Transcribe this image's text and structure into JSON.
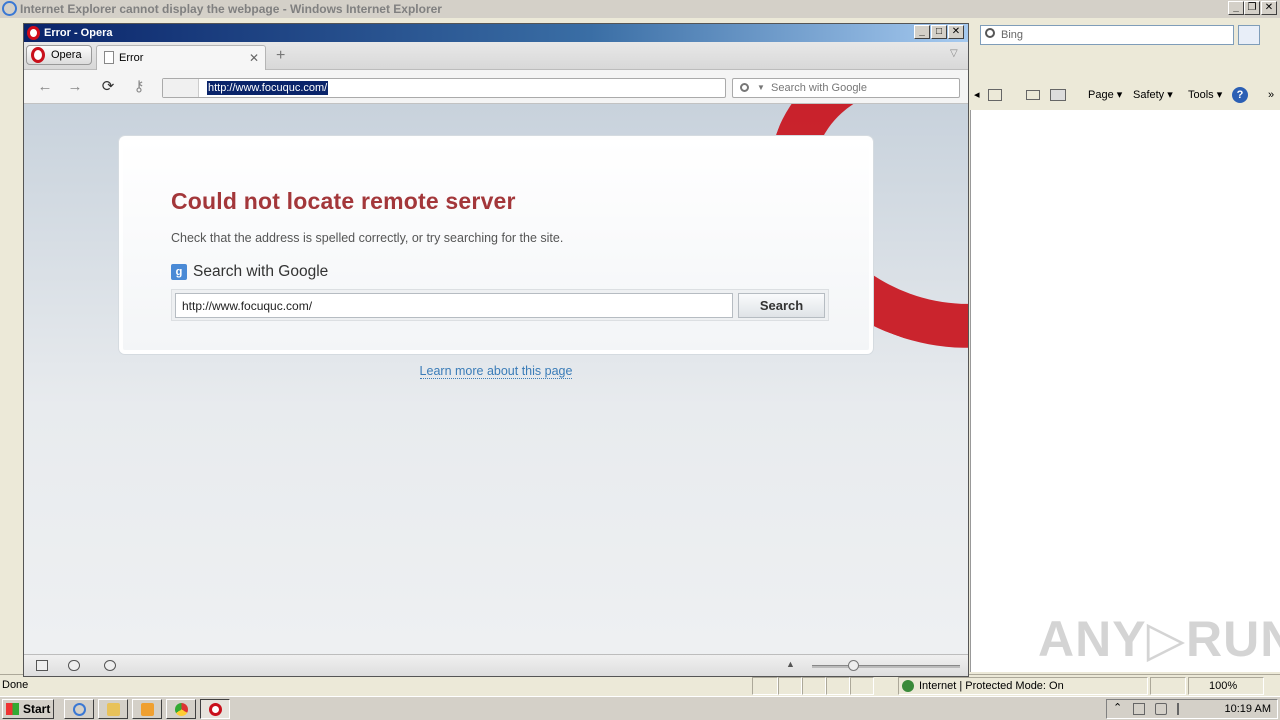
{
  "ie": {
    "title": "Internet Explorer cannot display the webpage - Windows Internet Explorer",
    "search_placeholder": "Bing",
    "cmd_page": "Page ▾",
    "cmd_safety": "Safety ▾",
    "cmd_tools": "Tools ▾",
    "cmd_help": "?",
    "status_done": "Done",
    "status_zone": "Internet | Protected Mode: On",
    "status_zoom": "100%",
    "chevron": "»"
  },
  "opera": {
    "title": "Error - Opera",
    "menu_label": "Opera",
    "tab_label": "Error",
    "tab_close": "✕",
    "new_tab": "+",
    "tab_menu": "▽",
    "url": "http://www.focuquc.com/",
    "search_placeholder": "Search with Google",
    "nav_back": "←",
    "nav_forward": "→",
    "nav_reload": "⟳",
    "nav_key": "⚷"
  },
  "error_page": {
    "heading": "Could not locate remote server",
    "subtext": "Check that the address is spelled correctly, or try searching for the site.",
    "search_header": "Search with Google",
    "google_icon": "g",
    "search_value": "http://www.focuquc.com/",
    "search_button": "Search",
    "learn_more": "Learn more about this page"
  },
  "taskbar": {
    "start_label": "Start",
    "clock": "10:19 AM"
  },
  "watermark": "ANY▷RUN",
  "colors": {
    "error_heading": "#a3373a",
    "link": "#3a7cb8",
    "opera_red": "#c9141e"
  }
}
